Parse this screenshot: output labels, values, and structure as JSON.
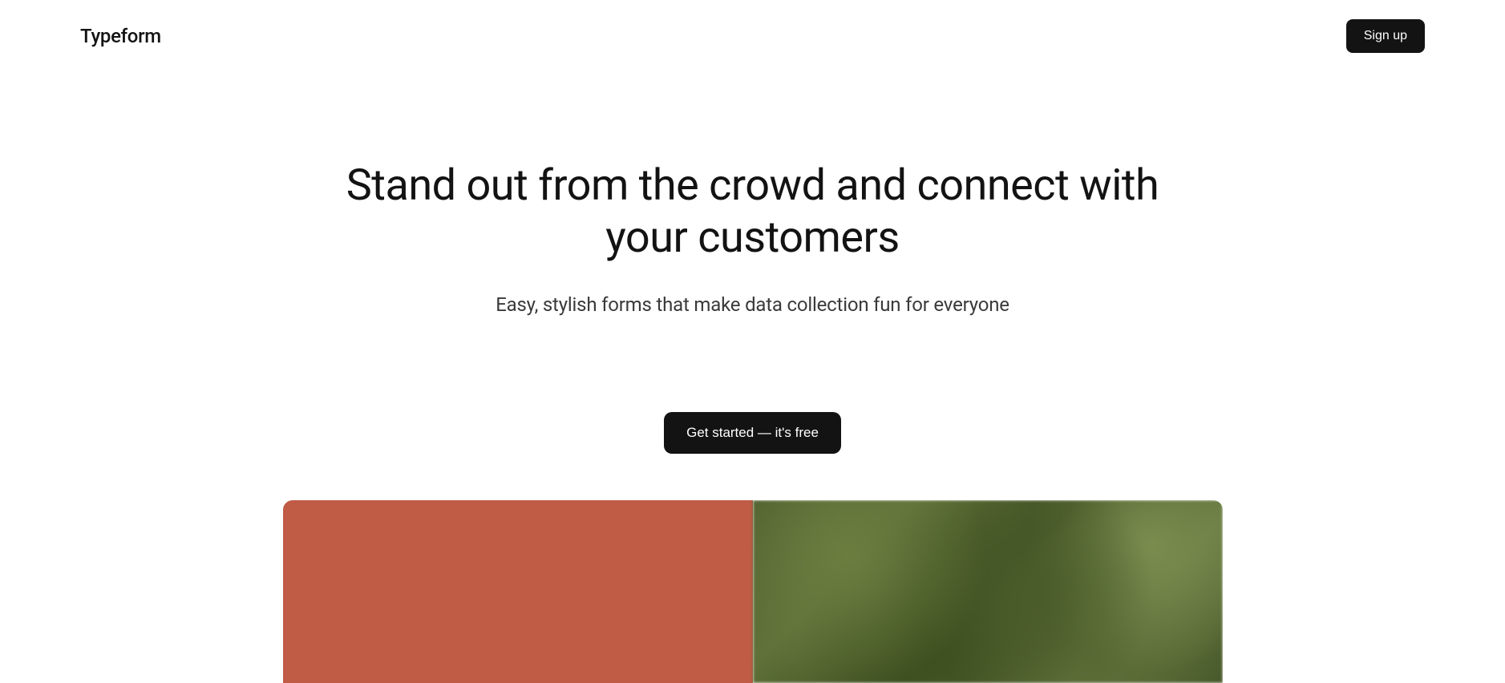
{
  "header": {
    "logo": "Typeform",
    "signup_label": "Sign up"
  },
  "hero": {
    "heading": "Stand out from the crowd and connect with your customers",
    "subheading": "Easy, stylish forms that make data collection fun for everyone"
  },
  "cta": {
    "label": "Get started — it's free"
  },
  "colors": {
    "accent_left": "#c05b46",
    "button_bg": "#131313",
    "text_primary": "#131313"
  }
}
